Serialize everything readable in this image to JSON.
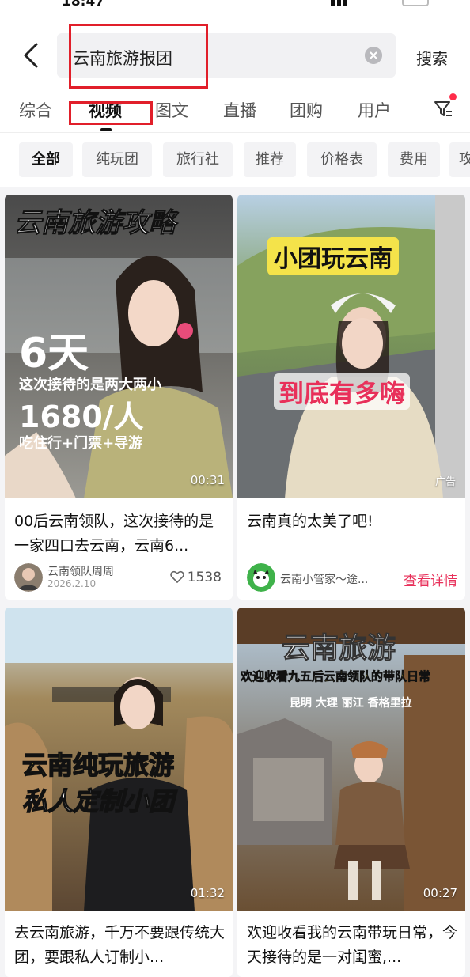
{
  "status": {
    "time": "18:47"
  },
  "search": {
    "value": "云南旅游报团",
    "button": "搜索"
  },
  "tabs": [
    "综合",
    "视频",
    "图文",
    "直播",
    "团购",
    "用户"
  ],
  "chips": [
    "全部",
    "纯玩团",
    "旅行社",
    "推荐",
    "价格表",
    "费用",
    "攻"
  ],
  "cards": [
    {
      "overlay_title": "云南旅游攻略",
      "overlay_days": "6天",
      "overlay_sub": "这次接待的是两大两小",
      "overlay_price": "1680/人",
      "overlay_inc": "吃住行+门票+导游",
      "duration": "00:31",
      "title": "00后云南领队，这次接待的是一家四口去云南，云南6...",
      "author": "云南领队周周",
      "date": "2026.2.10",
      "likes": "1538"
    },
    {
      "overlay_title": "小团玩云南",
      "overlay_sub": "到底有多嗨",
      "ad": "广告",
      "title": "云南真的太美了吧!",
      "author": "云南小管家～途...",
      "cta": "查看详情"
    },
    {
      "overlay_title": "云南纯玩旅游",
      "overlay_sub": "私人定制小团",
      "duration": "01:32",
      "title": "去云南旅游，千万不要跟传统大团，要跟私人订制小..."
    },
    {
      "overlay_title": "云南旅游",
      "overlay_sub": "欢迎收看九五后云南领队的带队日常",
      "overlay_places": "昆明 大理 丽江 香格里拉",
      "duration": "00:27",
      "title": "欢迎收看我的云南带玩日常，今天接待的是一对闺蜜,..."
    }
  ],
  "colors": {
    "accent": "#e8305a",
    "highlight": "#e11f2a",
    "chip_bg": "#f3f3f5"
  },
  "icons": [
    "back-arrow-icon",
    "clear-icon",
    "filter-icon",
    "heart-icon"
  ]
}
